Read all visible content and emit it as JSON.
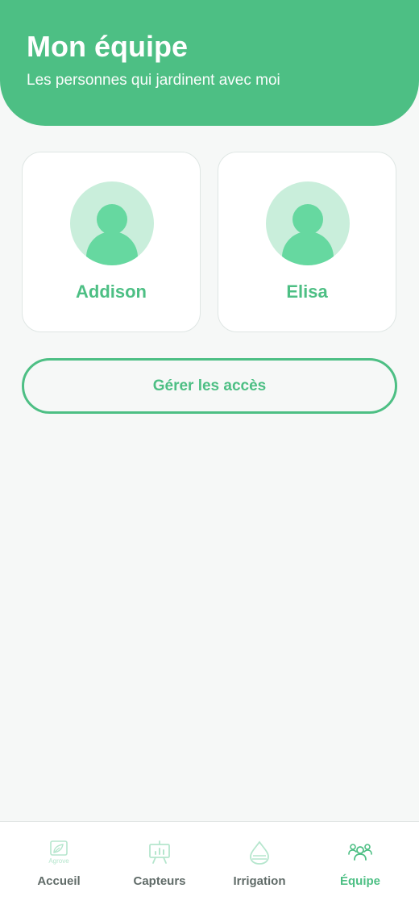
{
  "header": {
    "title": "Mon équipe",
    "subtitle": "Les personnes qui jardinent avec moi"
  },
  "team": {
    "members": [
      {
        "name": "Addison",
        "avatar_icon": "user-avatar-icon"
      },
      {
        "name": "Elisa",
        "avatar_icon": "user-avatar-icon"
      }
    ],
    "manage_label": "Gérer les accès"
  },
  "tabbar": {
    "items": [
      {
        "label": "Accueil",
        "icon": "agrove-logo-icon",
        "active": false
      },
      {
        "label": "Capteurs",
        "icon": "sensor-chart-icon",
        "active": false
      },
      {
        "label": "Irrigation",
        "icon": "water-drop-icon",
        "active": false
      },
      {
        "label": "Équipe",
        "icon": "team-icon",
        "active": true
      }
    ],
    "logo_text": "Agrove"
  },
  "colors": {
    "accent": "#4dbf84",
    "avatar_bg": "#c9eedb",
    "avatar_fg": "#66d8a0",
    "background": "#f6f8f7",
    "inactive_label": "#606b68",
    "inactive_icon": "#b5e6cd"
  }
}
